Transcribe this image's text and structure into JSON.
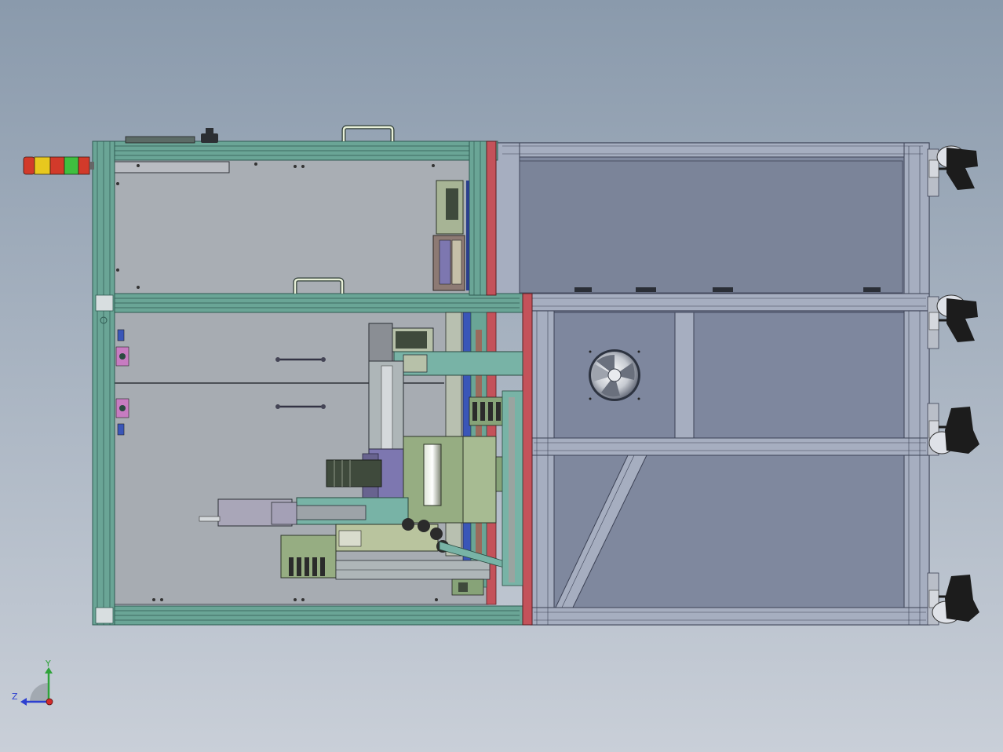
{
  "viewport": {
    "background_top": "#8a9aac",
    "background_bottom": "#c9cfd8"
  },
  "colors": {
    "frame_teal": "#5f9a8a",
    "frame_teal_dark": "#2f5a52",
    "frame_grey": "#9aa4ba",
    "frame_grey_dark": "#3c4255",
    "panel_grey": "#a9aeb4",
    "panel_blue": "#7e879e",
    "red_divider": "#c4525a",
    "mech_green": "#96ad82",
    "mech_purple": "#7d77b0",
    "mech_teal": "#78b3a6",
    "motor_dark": "#3f4a3c",
    "caster_black": "#1c1c1c",
    "signal_red": "#d23a2a",
    "signal_yellow": "#e8c81e",
    "signal_green": "#3fbf3f"
  },
  "icons": {
    "signal_tower": "signal-tower-icon",
    "handle": "handle-icon",
    "fan": "fan-icon",
    "caster": "caster-icon",
    "triad": "coordinate-triad-icon"
  },
  "triad": {
    "y_label": "Y",
    "z_label": "Z",
    "y_color": "#2fa33a",
    "z_color": "#2c3fd0",
    "origin_color": "#d22a2a"
  }
}
